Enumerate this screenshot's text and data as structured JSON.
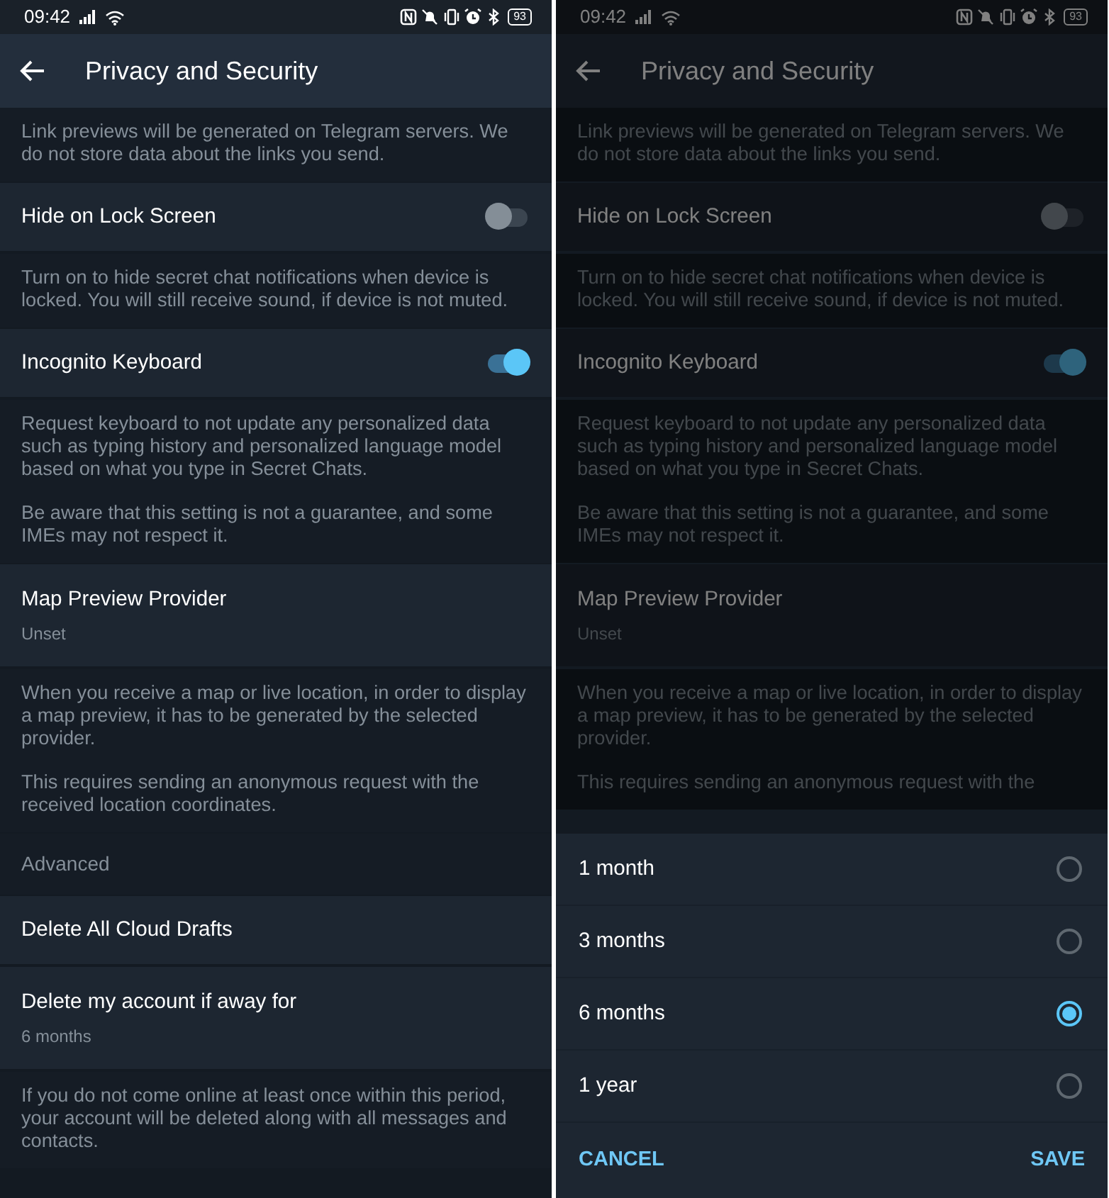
{
  "screens": [
    {
      "dimmed": false,
      "status_bar": {
        "time": "09:42",
        "battery": "93"
      },
      "title": "Privacy and Security",
      "items": [
        {
          "kind": "info",
          "paragraphs": [
            "Link previews will be generated on Telegram servers. We do not store data about the links you send."
          ]
        },
        {
          "kind": "toggle",
          "label": "Hide on Lock Screen",
          "on": false
        },
        {
          "kind": "info",
          "paragraphs": [
            "Turn on to hide secret chat notifications when device is locked. You will still receive sound, if device is not muted."
          ]
        },
        {
          "kind": "toggle",
          "label": "Incognito Keyboard",
          "on": true
        },
        {
          "kind": "info",
          "paragraphs": [
            "Request keyboard to not update any personalized data such as typing history and personalized language model based on what you type in Secret Chats.",
            "Be aware that this setting is not a guarantee, and some IMEs may not respect it."
          ]
        },
        {
          "kind": "setting",
          "label": "Map Preview Provider",
          "value": "Unset"
        },
        {
          "kind": "info",
          "paragraphs": [
            "When you receive a map or live location, in order to display a map preview, it has to be generated by the selected provider.",
            "This requires sending an anonymous request with the received location coordinates."
          ]
        },
        {
          "kind": "header",
          "label": "Advanced"
        },
        {
          "kind": "setting",
          "label": "Delete All Cloud Drafts"
        },
        {
          "kind": "setting",
          "label": "Delete my account if away for",
          "value": "6 months"
        },
        {
          "kind": "info",
          "paragraphs": [
            "If you do not come online at least once within this period, your account will be deleted along with all messages and contacts."
          ]
        }
      ]
    },
    {
      "dimmed": true,
      "status_bar": {
        "time": "09:42",
        "battery": "93"
      },
      "title": "Privacy and Security",
      "items": [
        {
          "kind": "info",
          "paragraphs": [
            "Link previews will be generated on Telegram servers. We do not store data about the links you send."
          ]
        },
        {
          "kind": "toggle",
          "label": "Hide on Lock Screen",
          "on": false
        },
        {
          "kind": "info",
          "paragraphs": [
            "Turn on to hide secret chat notifications when device is locked. You will still receive sound, if device is not muted."
          ]
        },
        {
          "kind": "toggle",
          "label": "Incognito Keyboard",
          "on": true
        },
        {
          "kind": "info",
          "paragraphs": [
            "Request keyboard to not update any personalized data such as typing history and personalized language model based on what you type in Secret Chats.",
            "Be aware that this setting is not a guarantee, and some IMEs may not respect it."
          ]
        },
        {
          "kind": "setting",
          "label": "Map Preview Provider",
          "value": "Unset"
        },
        {
          "kind": "info",
          "paragraphs": [
            "When you receive a map or live location, in order to display a map preview, it has to be generated by the selected provider.",
            "This requires sending an anonymous request with the"
          ]
        }
      ],
      "dialog": {
        "options": [
          {
            "label": "1 month",
            "selected": false
          },
          {
            "label": "3 months",
            "selected": false
          },
          {
            "label": "6 months",
            "selected": true
          },
          {
            "label": "1 year",
            "selected": false
          }
        ],
        "buttons": [
          "CANCEL",
          "SAVE"
        ]
      }
    }
  ]
}
